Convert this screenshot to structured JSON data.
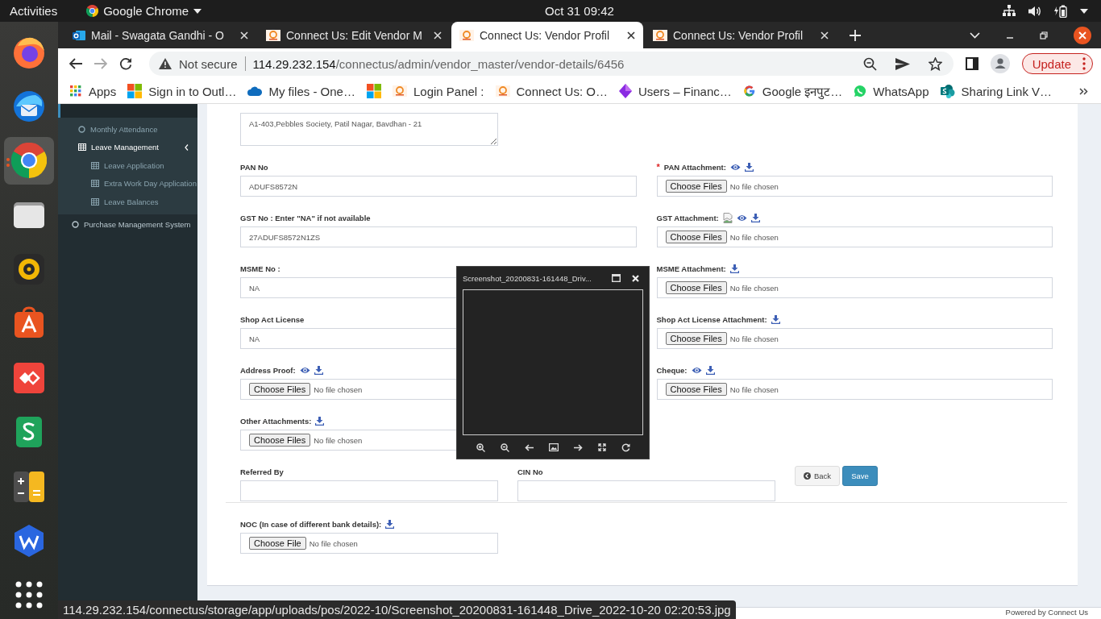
{
  "topbar": {
    "activities": "Activities",
    "app": "Google Chrome",
    "clock": "Oct 31  09:42"
  },
  "dock": [
    {
      "kind": "firefox",
      "active": false
    },
    {
      "kind": "thunderbird",
      "active": false
    },
    {
      "kind": "chrome",
      "active": true
    },
    {
      "kind": "files",
      "active": false
    },
    {
      "kind": "rhythmbox",
      "active": false
    },
    {
      "kind": "software",
      "active": false
    },
    {
      "kind": "anydesk",
      "active": false
    },
    {
      "kind": "sheets",
      "active": false
    },
    {
      "kind": "calculator",
      "active": false
    },
    {
      "kind": "wps",
      "active": false
    },
    {
      "kind": "apps",
      "active": false
    }
  ],
  "tabs": [
    {
      "title": "Mail - Swagata Gandhi - O",
      "kind": "mail",
      "selected": false
    },
    {
      "title": "Connect Us: Edit Vendor M",
      "kind": "connect",
      "selected": false
    },
    {
      "title": "Connect Us: Vendor Profil",
      "kind": "connect",
      "selected": true
    },
    {
      "title": "Connect Us: Vendor Profil",
      "kind": "connect",
      "selected": false
    }
  ],
  "toolbar": {
    "forward_disabled": true,
    "security": "Not secure",
    "host": "114.29.232.154",
    "path": "/connectus/admin/vendor_master/vendor-details/6456",
    "update": "Update"
  },
  "bookmarks": [
    {
      "label": "Apps",
      "kind": "grid"
    },
    {
      "label": "Sign in to Outl…",
      "kind": "windows"
    },
    {
      "label": "My files - One…",
      "kind": "cloud"
    },
    {
      "kind": "windows"
    },
    {
      "label": "Login Panel :",
      "kind": "connect"
    },
    {
      "label": "Connect Us: O…",
      "kind": "connect"
    },
    {
      "label": "Users – Financ…",
      "kind": "diamond"
    },
    {
      "label": "Google इनपुट…",
      "kind": "google"
    },
    {
      "label": "WhatsApp",
      "kind": "chat"
    },
    {
      "label": "Sharing Link V…",
      "kind": "sharepoint"
    }
  ],
  "sidebar": [
    {
      "label": "Monthly Attendance",
      "kind": "circle"
    },
    {
      "label": "Leave Management",
      "kind": "table",
      "expanded": true,
      "children": [
        {
          "label": "Leave Application",
          "kind": "table"
        },
        {
          "label": "Extra Work Day Application",
          "kind": "table"
        },
        {
          "label": "Leave Balances",
          "kind": "table"
        }
      ]
    },
    {
      "label": "Purchase Management System",
      "kind": "circle"
    }
  ],
  "form": {
    "address": {
      "kind": "textarea",
      "value": "A1-403,Pebbles Society, Patil Nagar, Bavdhan - 21"
    },
    "rows": [
      [
        {
          "label": "PAN No",
          "kind": "text",
          "value": "ADUFS8572N"
        },
        {
          "label": "PAN Attachment:",
          "kind": "file",
          "required_mark": "*",
          "preview": true,
          "download": true,
          "button": "Choose Files",
          "status": "No file chosen"
        }
      ],
      [
        {
          "label": "GST No : Enter \"NA\" if not available",
          "kind": "text",
          "value": "27ADUFS8572N1ZS"
        },
        {
          "label": "GST Attachment:",
          "kind": "file",
          "broken_image": true,
          "preview": true,
          "download": true,
          "button": "Choose Files",
          "status": "No file chosen"
        }
      ],
      [
        {
          "label": "MSME No :",
          "kind": "text",
          "value": "NA"
        },
        {
          "label": "MSME Attachment:",
          "kind": "file",
          "download": true,
          "button": "Choose Files",
          "status": "No file chosen"
        }
      ],
      [
        {
          "label": "Shop Act License",
          "kind": "text",
          "value": "NA"
        },
        {
          "label": "Shop Act License Attachment:",
          "kind": "file",
          "download": true,
          "button": "Choose Files",
          "status": "No file chosen"
        }
      ],
      [
        {
          "label": "Address Proof:",
          "kind": "file",
          "preview": true,
          "download": true,
          "button": "Choose Files",
          "status": "No file chosen"
        },
        {
          "label": "Cheque:",
          "kind": "file",
          "preview": true,
          "download": true,
          "button": "Choose Files",
          "status": "No file chosen"
        }
      ],
      [
        {
          "label": "Other Attachments:",
          "kind": "file",
          "download": true,
          "button": "Choose Files",
          "status": "No file chosen"
        }
      ]
    ],
    "referral": [
      {
        "label": "Referred By",
        "kind": "text"
      },
      {
        "label": "CIN No",
        "kind": "text"
      }
    ],
    "actions": [
      {
        "label": "Back",
        "kind": "back"
      },
      {
        "label": "Save",
        "kind": "save"
      }
    ],
    "noc": {
      "label": "NOC (In case of different bank details):",
      "kind": "file",
      "download": true,
      "button": "Choose File",
      "status": "No file chosen"
    }
  },
  "viewer": {
    "title": "Screenshot_20200831-161448_Driv..."
  },
  "status_url": "114.29.232.154/connectus/storage/app/uploads/pos/2022-10/Screenshot_20200831-161448_Drive_2022-10-20 02:20:53.jpg",
  "footer": "Powered by Connect Us"
}
